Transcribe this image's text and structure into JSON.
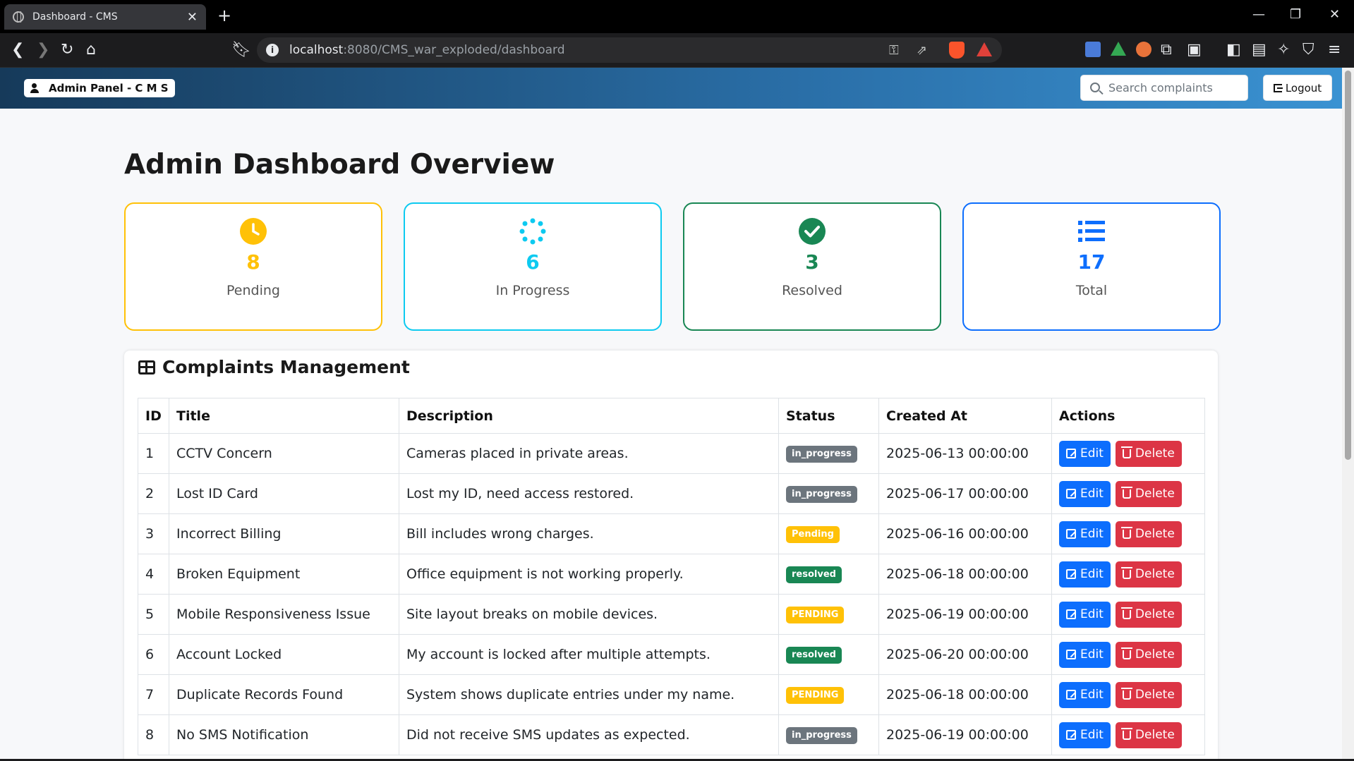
{
  "browser": {
    "tab_title": "Dashboard - CMS",
    "tab_close": "✕",
    "new_tab": "+",
    "url_host": "localhost",
    "url_path": ":8080/CMS_war_exploded/dashboard",
    "window_controls": [
      "—",
      "❐",
      "✕"
    ]
  },
  "navbar": {
    "brand": "Admin Panel - C M S",
    "search_placeholder": "Search complaints",
    "logout_label": "Logout",
    "colors": {
      "gradient_start": "#163a5a",
      "gradient_end": "#3a92d2"
    }
  },
  "page": {
    "title": "Admin Dashboard Overview"
  },
  "stats": [
    {
      "label": "Pending",
      "value": "8",
      "icon": "clock-icon",
      "color": "#ffc107"
    },
    {
      "label": "In Progress",
      "value": "6",
      "icon": "spinner-icon",
      "color": "#0dcaf0"
    },
    {
      "label": "Resolved",
      "value": "3",
      "icon": "check-circle-icon",
      "color": "#198754"
    },
    {
      "label": "Total",
      "value": "17",
      "icon": "list-icon",
      "color": "#0d6efd"
    }
  ],
  "complaints": {
    "title": "Complaints Management",
    "columns": [
      "ID",
      "Title",
      "Description",
      "Status",
      "Created At",
      "Actions"
    ],
    "edit_label": "Edit",
    "delete_label": "Delete",
    "rows": [
      {
        "id": "1",
        "title": "CCTV Concern",
        "description": "Cameras placed in private areas.",
        "status": "in_progress",
        "status_color": "gray",
        "created": "2025-06-13 00:00:00"
      },
      {
        "id": "2",
        "title": "Lost ID Card",
        "description": "Lost my ID, need access restored.",
        "status": "in_progress",
        "status_color": "gray",
        "created": "2025-06-17 00:00:00"
      },
      {
        "id": "3",
        "title": "Incorrect Billing",
        "description": "Bill includes wrong charges.",
        "status": "Pending",
        "status_color": "yellow",
        "created": "2025-06-16 00:00:00"
      },
      {
        "id": "4",
        "title": "Broken Equipment",
        "description": "Office equipment is not working properly.",
        "status": "resolved",
        "status_color": "green",
        "created": "2025-06-18 00:00:00"
      },
      {
        "id": "5",
        "title": "Mobile Responsiveness Issue",
        "description": "Site layout breaks on mobile devices.",
        "status": "PENDING",
        "status_color": "yellow",
        "created": "2025-06-19 00:00:00"
      },
      {
        "id": "6",
        "title": "Account Locked",
        "description": "My account is locked after multiple attempts.",
        "status": "resolved",
        "status_color": "green",
        "created": "2025-06-20 00:00:00"
      },
      {
        "id": "7",
        "title": "Duplicate Records Found",
        "description": "System shows duplicate entries under my name.",
        "status": "PENDING",
        "status_color": "yellow",
        "created": "2025-06-18 00:00:00"
      },
      {
        "id": "8",
        "title": "No SMS Notification",
        "description": "Did not receive SMS updates as expected.",
        "status": "in_progress",
        "status_color": "gray",
        "created": "2025-06-19 00:00:00"
      }
    ]
  }
}
